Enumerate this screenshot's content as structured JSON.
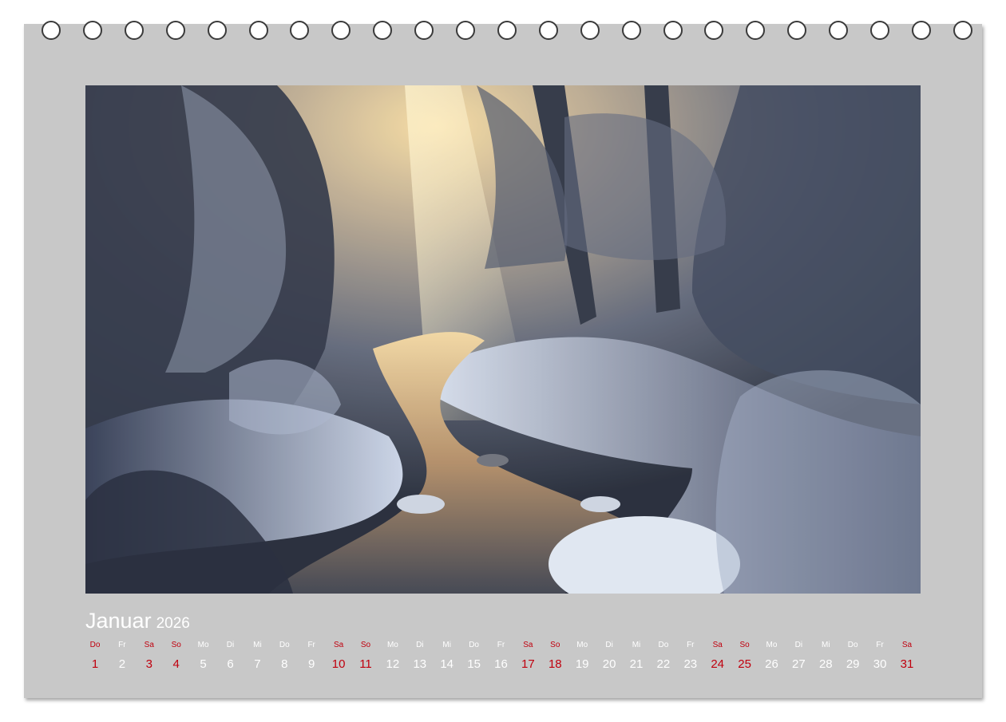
{
  "calendar": {
    "month": "Januar",
    "year": "2026",
    "photo_description": "",
    "days": [
      {
        "wd": "Do",
        "d": "1",
        "weekend": true
      },
      {
        "wd": "Fr",
        "d": "2",
        "weekend": false
      },
      {
        "wd": "Sa",
        "d": "3",
        "weekend": true
      },
      {
        "wd": "So",
        "d": "4",
        "weekend": true
      },
      {
        "wd": "Mo",
        "d": "5",
        "weekend": false
      },
      {
        "wd": "Di",
        "d": "6",
        "weekend": false
      },
      {
        "wd": "Mi",
        "d": "7",
        "weekend": false
      },
      {
        "wd": "Do",
        "d": "8",
        "weekend": false
      },
      {
        "wd": "Fr",
        "d": "9",
        "weekend": false
      },
      {
        "wd": "Sa",
        "d": "10",
        "weekend": true
      },
      {
        "wd": "So",
        "d": "11",
        "weekend": true
      },
      {
        "wd": "Mo",
        "d": "12",
        "weekend": false
      },
      {
        "wd": "Di",
        "d": "13",
        "weekend": false
      },
      {
        "wd": "Mi",
        "d": "14",
        "weekend": false
      },
      {
        "wd": "Do",
        "d": "15",
        "weekend": false
      },
      {
        "wd": "Fr",
        "d": "16",
        "weekend": false
      },
      {
        "wd": "Sa",
        "d": "17",
        "weekend": true
      },
      {
        "wd": "So",
        "d": "18",
        "weekend": true
      },
      {
        "wd": "Mo",
        "d": "19",
        "weekend": false
      },
      {
        "wd": "Di",
        "d": "20",
        "weekend": false
      },
      {
        "wd": "Mi",
        "d": "21",
        "weekend": false
      },
      {
        "wd": "Do",
        "d": "22",
        "weekend": false
      },
      {
        "wd": "Fr",
        "d": "23",
        "weekend": false
      },
      {
        "wd": "Sa",
        "d": "24",
        "weekend": true
      },
      {
        "wd": "So",
        "d": "25",
        "weekend": true
      },
      {
        "wd": "Mo",
        "d": "26",
        "weekend": false
      },
      {
        "wd": "Di",
        "d": "27",
        "weekend": false
      },
      {
        "wd": "Mi",
        "d": "28",
        "weekend": false
      },
      {
        "wd": "Do",
        "d": "29",
        "weekend": false
      },
      {
        "wd": "Fr",
        "d": "30",
        "weekend": false
      },
      {
        "wd": "Sa",
        "d": "31",
        "weekend": true
      }
    ]
  },
  "colors": {
    "sheet": "#c8c8c8",
    "weekday_text": "#ffffff",
    "holiday_weekend_text": "#c0000e"
  }
}
